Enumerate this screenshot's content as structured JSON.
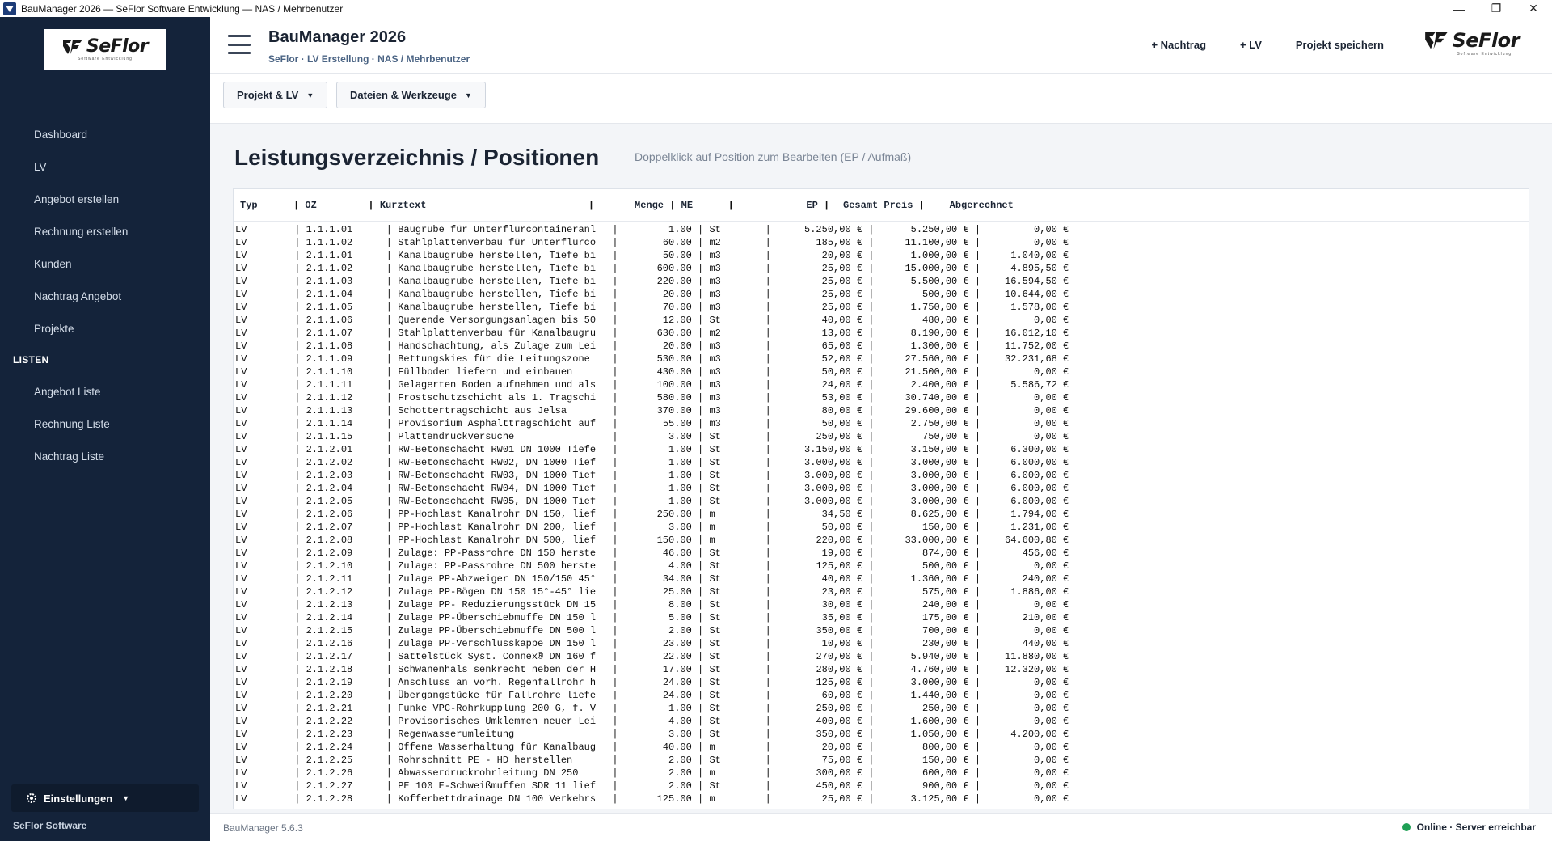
{
  "window": {
    "title": "BauManager 2026 — SeFlor Software Entwicklung — NAS / Mehrbenutzer",
    "controls": {
      "minimize": "—",
      "restore": "❐",
      "close": "✕"
    }
  },
  "brand": {
    "logo_text": "SeFlor",
    "logo_sub": "Software Entwicklung"
  },
  "sidebar": {
    "items": [
      {
        "label": "Dashboard"
      },
      {
        "label": "LV"
      },
      {
        "label": "Angebot erstellen"
      },
      {
        "label": "Rechnung erstellen"
      },
      {
        "label": "Kunden"
      },
      {
        "label": "Nachtrag Angebot"
      },
      {
        "label": "Projekte"
      }
    ],
    "section_lists": "LISTEN",
    "list_items": [
      {
        "label": "Angebot Liste"
      },
      {
        "label": "Rechnung Liste"
      },
      {
        "label": "Nachtrag Liste"
      }
    ],
    "settings_label": "Einstellungen",
    "footer": "SeFlor Software"
  },
  "header": {
    "title": "BauManager 2026",
    "subtitle": "SeFlor · LV Erstellung · NAS / Mehrbenutzer",
    "actions": {
      "nachtrag": "+ Nachtrag",
      "lv": "+ LV",
      "save": "Projekt speichern"
    }
  },
  "toolbar": {
    "project_menu": "Projekt & LV",
    "files_menu": "Dateien & Werkzeuge"
  },
  "main": {
    "title": "Leistungsverzeichnis / Positionen",
    "hint": "Doppelklick auf Position zum Bearbeiten (EP / Aufmaß)",
    "columns": {
      "typ": "Typ",
      "oz": "OZ",
      "kurztext": "Kurztext",
      "menge": "Menge",
      "me": "ME",
      "ep": "EP",
      "gesamt": "Gesamt Preis",
      "abgerechnet": "Abgerechnet"
    },
    "rows": [
      {
        "typ": "LV",
        "oz": "1.1.1.01",
        "kurztext": "Baugrube für Unterflurcontaineranl",
        "menge": "1.00",
        "me": "St",
        "ep": "5.250,00 €",
        "gesamt": "5.250,00 €",
        "abgerechnet": "0,00 €"
      },
      {
        "typ": "LV",
        "oz": "1.1.1.02",
        "kurztext": "Stahlplattenverbau für Unterflurco",
        "menge": "60.00",
        "me": "m2",
        "ep": "185,00 €",
        "gesamt": "11.100,00 €",
        "abgerechnet": "0,00 €"
      },
      {
        "typ": "LV",
        "oz": "2.1.1.01",
        "kurztext": "Kanalbaugrube herstellen, Tiefe bi",
        "menge": "50.00",
        "me": "m3",
        "ep": "20,00 €",
        "gesamt": "1.000,00 €",
        "abgerechnet": "1.040,00 €"
      },
      {
        "typ": "LV",
        "oz": "2.1.1.02",
        "kurztext": "Kanalbaugrube herstellen, Tiefe bi",
        "menge": "600.00",
        "me": "m3",
        "ep": "25,00 €",
        "gesamt": "15.000,00 €",
        "abgerechnet": "4.895,50 €"
      },
      {
        "typ": "LV",
        "oz": "2.1.1.03",
        "kurztext": "Kanalbaugrube herstellen, Tiefe bi",
        "menge": "220.00",
        "me": "m3",
        "ep": "25,00 €",
        "gesamt": "5.500,00 €",
        "abgerechnet": "16.594,50 €"
      },
      {
        "typ": "LV",
        "oz": "2.1.1.04",
        "kurztext": "Kanalbaugrube herstellen, Tiefe bi",
        "menge": "20.00",
        "me": "m3",
        "ep": "25,00 €",
        "gesamt": "500,00 €",
        "abgerechnet": "10.644,00 €"
      },
      {
        "typ": "LV",
        "oz": "2.1.1.05",
        "kurztext": "Kanalbaugrube herstellen, Tiefe bi",
        "menge": "70.00",
        "me": "m3",
        "ep": "25,00 €",
        "gesamt": "1.750,00 €",
        "abgerechnet": "1.578,00 €"
      },
      {
        "typ": "LV",
        "oz": "2.1.1.06",
        "kurztext": "Querende Versorgungsanlagen bis 50",
        "menge": "12.00",
        "me": "St",
        "ep": "40,00 €",
        "gesamt": "480,00 €",
        "abgerechnet": "0,00 €"
      },
      {
        "typ": "LV",
        "oz": "2.1.1.07",
        "kurztext": "Stahlplattenverbau für Kanalbaugru",
        "menge": "630.00",
        "me": "m2",
        "ep": "13,00 €",
        "gesamt": "8.190,00 €",
        "abgerechnet": "16.012,10 €"
      },
      {
        "typ": "LV",
        "oz": "2.1.1.08",
        "kurztext": "Handschachtung, als Zulage zum Lei",
        "menge": "20.00",
        "me": "m3",
        "ep": "65,00 €",
        "gesamt": "1.300,00 €",
        "abgerechnet": "11.752,00 €"
      },
      {
        "typ": "LV",
        "oz": "2.1.1.09",
        "kurztext": "Bettungskies für die Leitungszone",
        "menge": "530.00",
        "me": "m3",
        "ep": "52,00 €",
        "gesamt": "27.560,00 €",
        "abgerechnet": "32.231,68 €"
      },
      {
        "typ": "LV",
        "oz": "2.1.1.10",
        "kurztext": "Füllboden liefern und einbauen",
        "menge": "430.00",
        "me": "m3",
        "ep": "50,00 €",
        "gesamt": "21.500,00 €",
        "abgerechnet": "0,00 €"
      },
      {
        "typ": "LV",
        "oz": "2.1.1.11",
        "kurztext": "Gelagerten Boden aufnehmen und als",
        "menge": "100.00",
        "me": "m3",
        "ep": "24,00 €",
        "gesamt": "2.400,00 €",
        "abgerechnet": "5.586,72 €"
      },
      {
        "typ": "LV",
        "oz": "2.1.1.12",
        "kurztext": "Frostschutzschicht als 1. Tragschi",
        "menge": "580.00",
        "me": "m3",
        "ep": "53,00 €",
        "gesamt": "30.740,00 €",
        "abgerechnet": "0,00 €"
      },
      {
        "typ": "LV",
        "oz": "2.1.1.13",
        "kurztext": "Schottertragschicht aus Jelsa",
        "menge": "370.00",
        "me": "m3",
        "ep": "80,00 €",
        "gesamt": "29.600,00 €",
        "abgerechnet": "0,00 €"
      },
      {
        "typ": "LV",
        "oz": "2.1.1.14",
        "kurztext": "Provisorium Asphalttragschicht auf",
        "menge": "55.00",
        "me": "m3",
        "ep": "50,00 €",
        "gesamt": "2.750,00 €",
        "abgerechnet": "0,00 €"
      },
      {
        "typ": "LV",
        "oz": "2.1.1.15",
        "kurztext": "Plattendruckversuche",
        "menge": "3.00",
        "me": "St",
        "ep": "250,00 €",
        "gesamt": "750,00 €",
        "abgerechnet": "0,00 €"
      },
      {
        "typ": "LV",
        "oz": "2.1.2.01",
        "kurztext": "RW-Betonschacht RW01 DN 1000 Tiefe",
        "menge": "1.00",
        "me": "St",
        "ep": "3.150,00 €",
        "gesamt": "3.150,00 €",
        "abgerechnet": "6.300,00 €"
      },
      {
        "typ": "LV",
        "oz": "2.1.2.02",
        "kurztext": "RW-Betonschacht RW02, DN 1000 Tief",
        "menge": "1.00",
        "me": "St",
        "ep": "3.000,00 €",
        "gesamt": "3.000,00 €",
        "abgerechnet": "6.000,00 €"
      },
      {
        "typ": "LV",
        "oz": "2.1.2.03",
        "kurztext": "RW-Betonschacht RW03, DN 1000 Tief",
        "menge": "1.00",
        "me": "St",
        "ep": "3.000,00 €",
        "gesamt": "3.000,00 €",
        "abgerechnet": "6.000,00 €"
      },
      {
        "typ": "LV",
        "oz": "2.1.2.04",
        "kurztext": "RW-Betonschacht RW04, DN 1000 Tief",
        "menge": "1.00",
        "me": "St",
        "ep": "3.000,00 €",
        "gesamt": "3.000,00 €",
        "abgerechnet": "6.000,00 €"
      },
      {
        "typ": "LV",
        "oz": "2.1.2.05",
        "kurztext": "RW-Betonschacht RW05, DN 1000 Tief",
        "menge": "1.00",
        "me": "St",
        "ep": "3.000,00 €",
        "gesamt": "3.000,00 €",
        "abgerechnet": "6.000,00 €"
      },
      {
        "typ": "LV",
        "oz": "2.1.2.06",
        "kurztext": "PP-Hochlast Kanalrohr DN 150, lief",
        "menge": "250.00",
        "me": "m",
        "ep": "34,50 €",
        "gesamt": "8.625,00 €",
        "abgerechnet": "1.794,00 €"
      },
      {
        "typ": "LV",
        "oz": "2.1.2.07",
        "kurztext": "PP-Hochlast Kanalrohr DN 200, lief",
        "menge": "3.00",
        "me": "m",
        "ep": "50,00 €",
        "gesamt": "150,00 €",
        "abgerechnet": "1.231,00 €"
      },
      {
        "typ": "LV",
        "oz": "2.1.2.08",
        "kurztext": "PP-Hochlast Kanalrohr DN 500, lief",
        "menge": "150.00",
        "me": "m",
        "ep": "220,00 €",
        "gesamt": "33.000,00 €",
        "abgerechnet": "64.600,80 €"
      },
      {
        "typ": "LV",
        "oz": "2.1.2.09",
        "kurztext": "Zulage: PP-Passrohre DN 150 herste",
        "menge": "46.00",
        "me": "St",
        "ep": "19,00 €",
        "gesamt": "874,00 €",
        "abgerechnet": "456,00 €"
      },
      {
        "typ": "LV",
        "oz": "2.1.2.10",
        "kurztext": "Zulage: PP-Passrohre DN 500 herste",
        "menge": "4.00",
        "me": "St",
        "ep": "125,00 €",
        "gesamt": "500,00 €",
        "abgerechnet": "0,00 €"
      },
      {
        "typ": "LV",
        "oz": "2.1.2.11",
        "kurztext": "Zulage PP-Abzweiger DN 150/150 45°",
        "menge": "34.00",
        "me": "St",
        "ep": "40,00 €",
        "gesamt": "1.360,00 €",
        "abgerechnet": "240,00 €"
      },
      {
        "typ": "LV",
        "oz": "2.1.2.12",
        "kurztext": "Zulage PP-Bögen DN 150 15°-45° lie",
        "menge": "25.00",
        "me": "St",
        "ep": "23,00 €",
        "gesamt": "575,00 €",
        "abgerechnet": "1.886,00 €"
      },
      {
        "typ": "LV",
        "oz": "2.1.2.13",
        "kurztext": "Zulage PP- Reduzierungsstück DN 15",
        "menge": "8.00",
        "me": "St",
        "ep": "30,00 €",
        "gesamt": "240,00 €",
        "abgerechnet": "0,00 €"
      },
      {
        "typ": "LV",
        "oz": "2.1.2.14",
        "kurztext": "Zulage PP-Überschiebmuffe DN 150 l",
        "menge": "5.00",
        "me": "St",
        "ep": "35,00 €",
        "gesamt": "175,00 €",
        "abgerechnet": "210,00 €"
      },
      {
        "typ": "LV",
        "oz": "2.1.2.15",
        "kurztext": "Zulage PP-Überschiebmuffe DN 500 l",
        "menge": "2.00",
        "me": "St",
        "ep": "350,00 €",
        "gesamt": "700,00 €",
        "abgerechnet": "0,00 €"
      },
      {
        "typ": "LV",
        "oz": "2.1.2.16",
        "kurztext": "Zulage PP-Verschlusskappe DN 150 l",
        "menge": "23.00",
        "me": "St",
        "ep": "10,00 €",
        "gesamt": "230,00 €",
        "abgerechnet": "440,00 €"
      },
      {
        "typ": "LV",
        "oz": "2.1.2.17",
        "kurztext": "Sattelstück Syst. Connex® DN 160 f",
        "menge": "22.00",
        "me": "St",
        "ep": "270,00 €",
        "gesamt": "5.940,00 €",
        "abgerechnet": "11.880,00 €"
      },
      {
        "typ": "LV",
        "oz": "2.1.2.18",
        "kurztext": "Schwanenhals senkrecht neben der H",
        "menge": "17.00",
        "me": "St",
        "ep": "280,00 €",
        "gesamt": "4.760,00 €",
        "abgerechnet": "12.320,00 €"
      },
      {
        "typ": "LV",
        "oz": "2.1.2.19",
        "kurztext": "Anschluss an vorh. Regenfallrohr h",
        "menge": "24.00",
        "me": "St",
        "ep": "125,00 €",
        "gesamt": "3.000,00 €",
        "abgerechnet": "0,00 €"
      },
      {
        "typ": "LV",
        "oz": "2.1.2.20",
        "kurztext": "Übergangstücke für Fallrohre liefe",
        "menge": "24.00",
        "me": "St",
        "ep": "60,00 €",
        "gesamt": "1.440,00 €",
        "abgerechnet": "0,00 €"
      },
      {
        "typ": "LV",
        "oz": "2.1.2.21",
        "kurztext": "Funke VPC-Rohrkupplung 200 G, f. V",
        "menge": "1.00",
        "me": "St",
        "ep": "250,00 €",
        "gesamt": "250,00 €",
        "abgerechnet": "0,00 €"
      },
      {
        "typ": "LV",
        "oz": "2.1.2.22",
        "kurztext": "Provisorisches Umklemmen neuer Lei",
        "menge": "4.00",
        "me": "St",
        "ep": "400,00 €",
        "gesamt": "1.600,00 €",
        "abgerechnet": "0,00 €"
      },
      {
        "typ": "LV",
        "oz": "2.1.2.23",
        "kurztext": "Regenwasserumleitung",
        "menge": "3.00",
        "me": "St",
        "ep": "350,00 €",
        "gesamt": "1.050,00 €",
        "abgerechnet": "4.200,00 €"
      },
      {
        "typ": "LV",
        "oz": "2.1.2.24",
        "kurztext": "Offene Wasserhaltung für Kanalbaug",
        "menge": "40.00",
        "me": "m",
        "ep": "20,00 €",
        "gesamt": "800,00 €",
        "abgerechnet": "0,00 €"
      },
      {
        "typ": "LV",
        "oz": "2.1.2.25",
        "kurztext": "Rohrschnitt PE - HD herstellen",
        "menge": "2.00",
        "me": "St",
        "ep": "75,00 €",
        "gesamt": "150,00 €",
        "abgerechnet": "0,00 €"
      },
      {
        "typ": "LV",
        "oz": "2.1.2.26",
        "kurztext": "Abwasserdruckrohrleitung DN 250",
        "menge": "2.00",
        "me": "m",
        "ep": "300,00 €",
        "gesamt": "600,00 €",
        "abgerechnet": "0,00 €"
      },
      {
        "typ": "LV",
        "oz": "2.1.2.27",
        "kurztext": "PE 100 E-Schweißmuffen SDR 11 lief",
        "menge": "2.00",
        "me": "St",
        "ep": "450,00 €",
        "gesamt": "900,00 €",
        "abgerechnet": "0,00 €"
      },
      {
        "typ": "LV",
        "oz": "2.1.2.28",
        "kurztext": "Kofferbettdrainage DN 100 Verkehrs",
        "menge": "125.00",
        "me": "m",
        "ep": "25,00 €",
        "gesamt": "3.125,00 €",
        "abgerechnet": "0,00 €"
      }
    ]
  },
  "status": {
    "version": "BauManager 5.6.3",
    "connection": "Online · Server erreichbar",
    "connection_color": "#1fa055"
  },
  "colors": {
    "sidebar": "#14233a",
    "main_bg": "#f3f5f8"
  }
}
